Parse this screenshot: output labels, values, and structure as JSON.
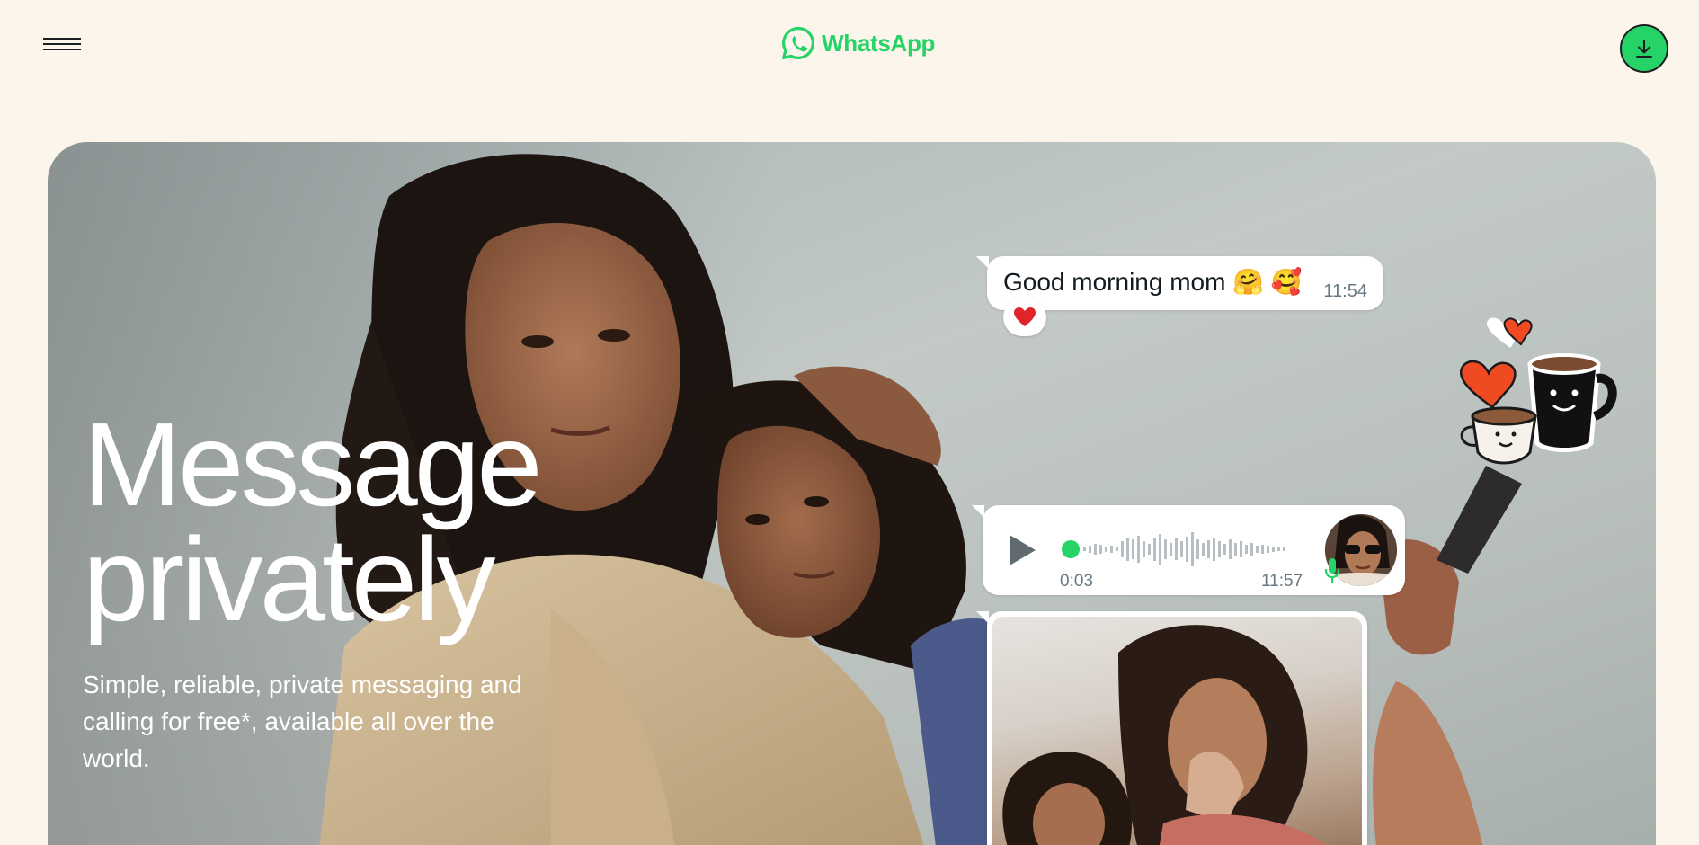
{
  "header": {
    "menu_icon": "hamburger-menu-icon",
    "logo": {
      "icon": "whatsapp-logo-icon",
      "text": "WhatsApp",
      "color": "#25d366"
    },
    "download_icon": "download-icon",
    "download_color": "#25d366"
  },
  "hero": {
    "title_line1": "Message",
    "title_line2": "privately",
    "subtitle": "Simple, reliable, private messaging and calling for free*, available all over the world."
  },
  "chat": {
    "text_message": "Good morning mom 🤗 🥰",
    "text_time": "11:54",
    "reaction": "❤️",
    "voice": {
      "duration": "0:03",
      "time": "11:57",
      "play_icon": "play-icon",
      "mic_icon": "microphone-icon"
    },
    "sticker_icon": "coffee-cups-hearts-sticker"
  },
  "colors": {
    "page_background": "#fcf5eb",
    "brand_green": "#25d366",
    "text_dark": "#1c1e21"
  }
}
